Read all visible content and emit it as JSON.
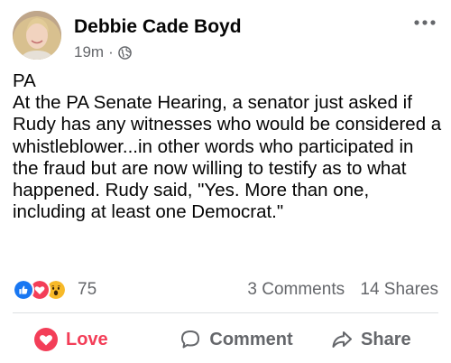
{
  "post": {
    "author": "Debbie Cade Boyd",
    "time": "19m",
    "separator": "·",
    "audience_icon": "globe-icon",
    "lines": [
      "PA",
      "At the PA Senate Hearing, a senator just asked if Rudy has any witnesses who would be considered a whistleblower...in other words who participated in the fraud but are now willing to testify as to what happened. Rudy said, \"Yes. More than one, including at least one Democrat.\""
    ]
  },
  "reactions": {
    "icons": [
      "like-icon",
      "love-icon",
      "wow-icon"
    ],
    "count": "75",
    "comments": "3 Comments",
    "shares": "14 Shares"
  },
  "actions": {
    "love": "Love",
    "comment": "Comment",
    "share": "Share"
  },
  "colors": {
    "love": "#f33e58",
    "like": "#1877f2",
    "wow": "#f7b928",
    "secondary_text": "#65676b"
  }
}
